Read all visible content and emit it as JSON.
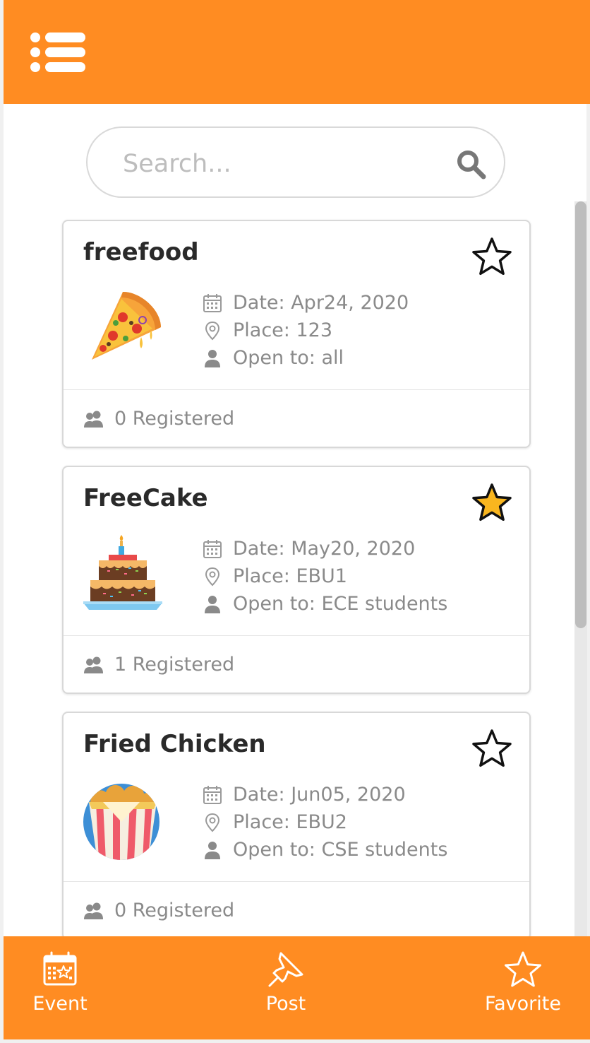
{
  "header": {
    "menu_icon": "menu-list-icon"
  },
  "search": {
    "placeholder": "Search...",
    "value": "",
    "icon": "search-icon"
  },
  "colors": {
    "accent": "#ff8c22",
    "text_dark": "#2a2a2a",
    "text_muted": "#8a8a8a",
    "star_active": "#f9b61f",
    "border": "#d8d8d8"
  },
  "events": [
    {
      "title": "freefood",
      "image": "pizza-slice-image",
      "favorited": false,
      "date": "Date: Apr24, 2020",
      "place": "Place: 123",
      "open_to": "Open to: all",
      "registered": "0 Registered"
    },
    {
      "title": "FreeCake",
      "image": "birthday-cake-image",
      "favorited": true,
      "date": "Date: May20, 2020",
      "place": "Place: EBU1",
      "open_to": "Open to: ECE students",
      "registered": "1 Registered"
    },
    {
      "title": "Fried Chicken",
      "image": "fried-chicken-bucket-image",
      "favorited": false,
      "date": "Date: Jun05, 2020",
      "place": "Place: EBU2",
      "open_to": "Open to: CSE students",
      "registered": "0 Registered"
    }
  ],
  "bottom_nav": [
    {
      "label": "Event",
      "icon": "calendar-star-icon"
    },
    {
      "label": "Post",
      "icon": "pushpin-icon"
    },
    {
      "label": "Favorite",
      "icon": "star-icon"
    }
  ]
}
